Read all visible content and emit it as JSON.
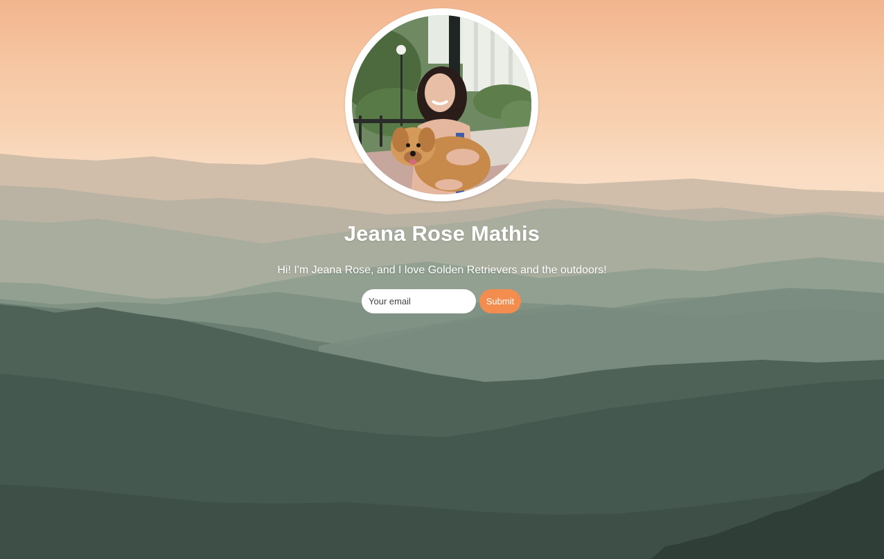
{
  "profile": {
    "name": "Jeana Rose Mathis",
    "bio": "Hi! I'm Jeana Rose, and I love Golden Retrievers and the outdoors!"
  },
  "signup": {
    "email_placeholder": "Your email",
    "submit_label": "Submit"
  },
  "colors": {
    "accent": "#f28c4f",
    "sky_top": "#f2b58e",
    "sky_bottom": "#fadcc2",
    "mountain_dark": "#3c4e46"
  }
}
